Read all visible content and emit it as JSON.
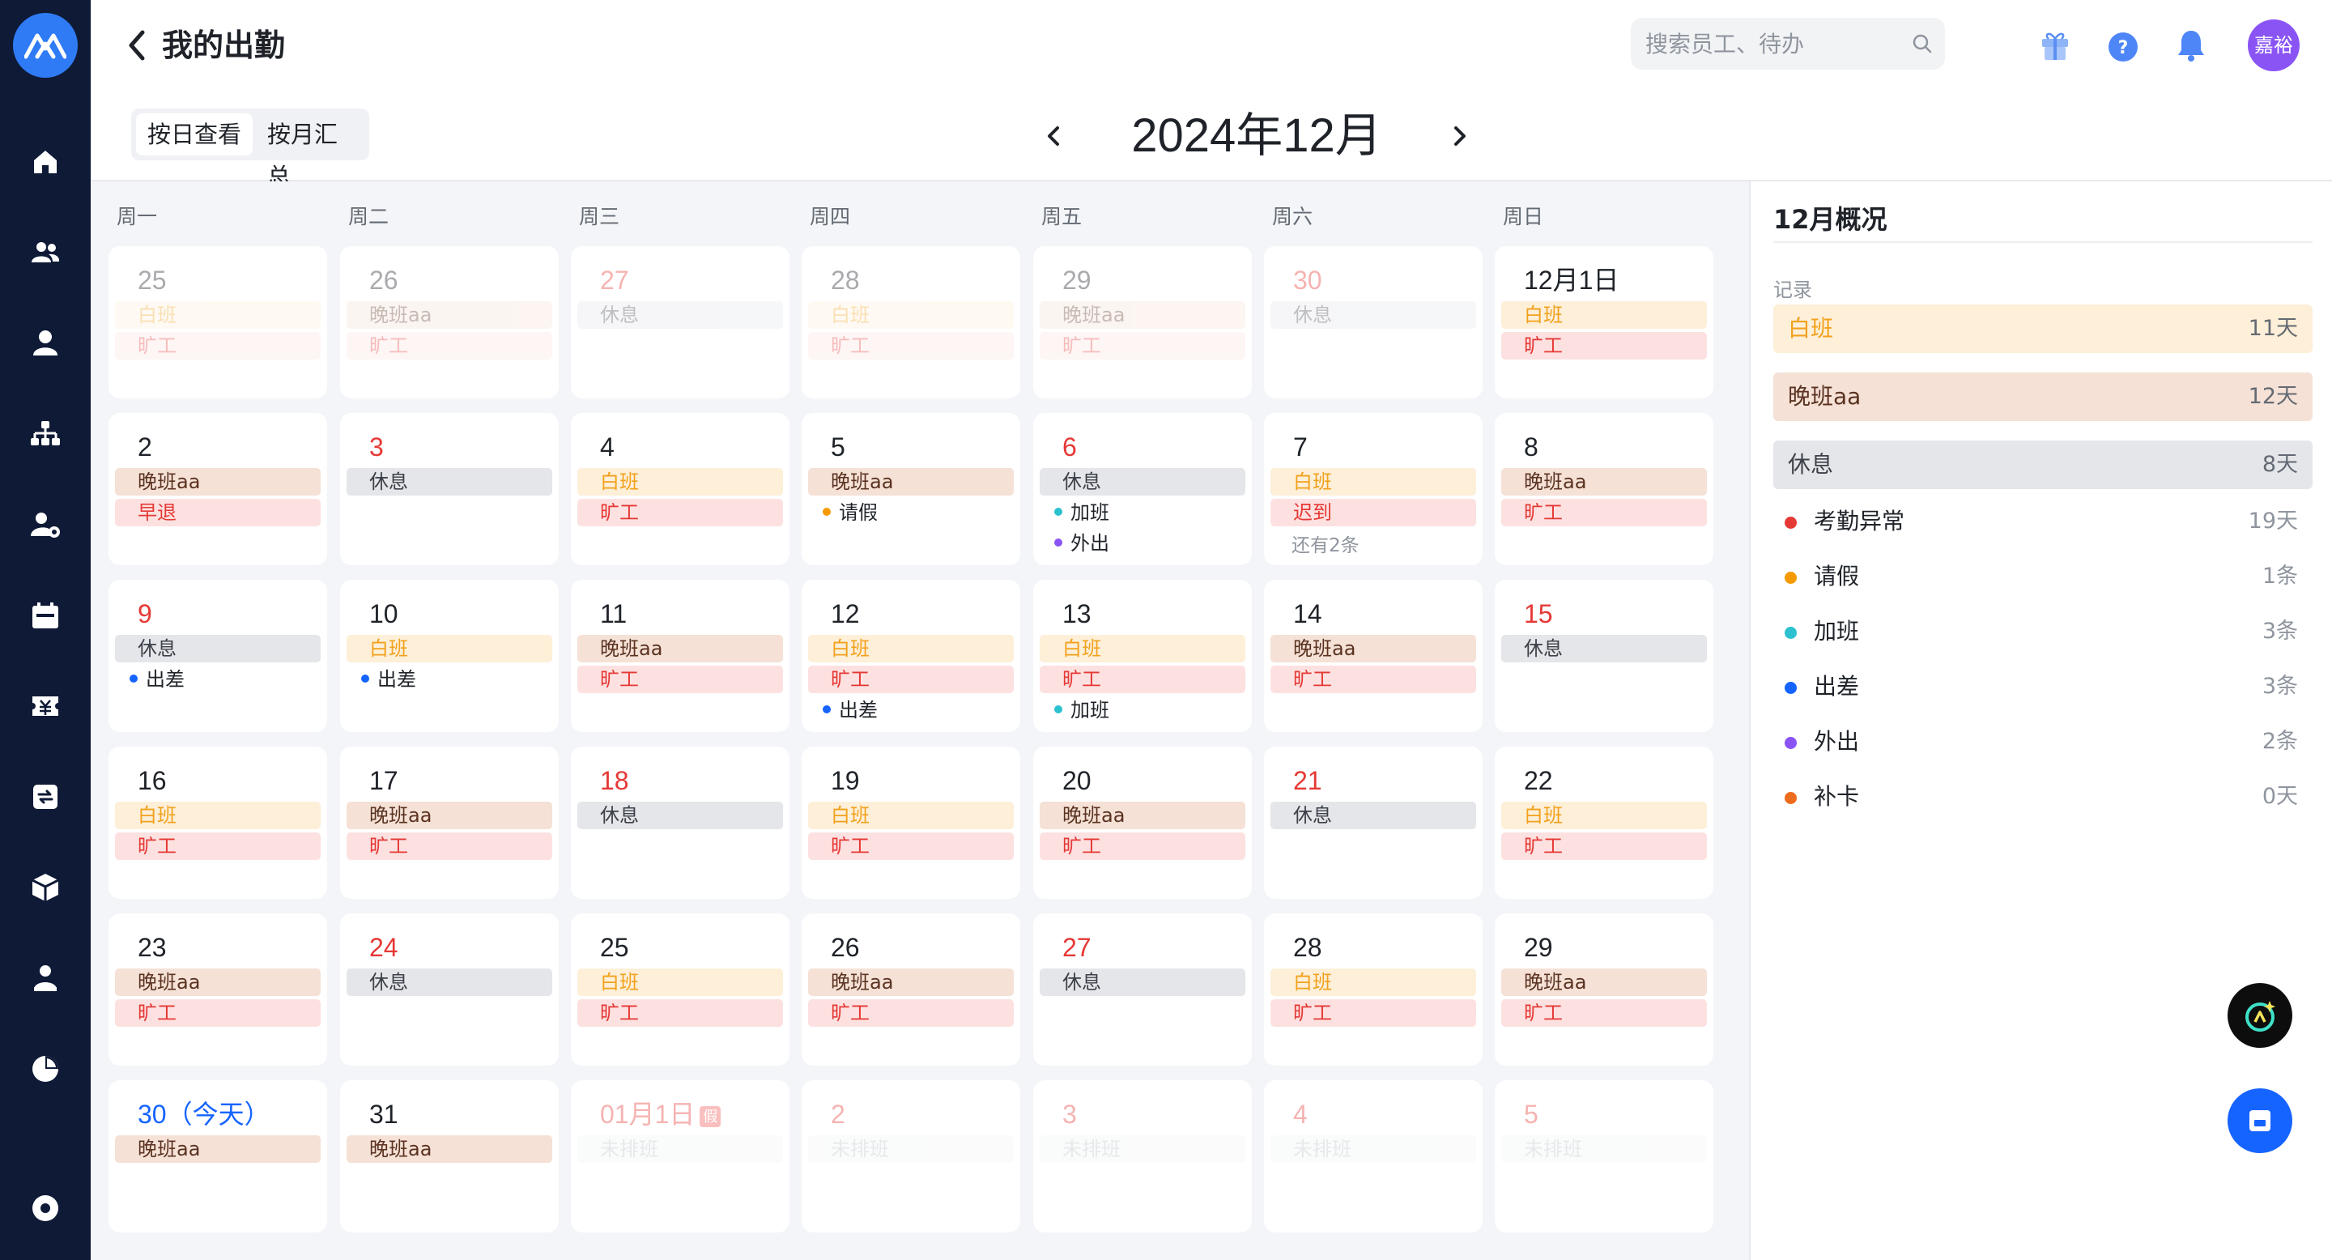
{
  "header": {
    "title": "我的出勤",
    "search_placeholder": "搜索员工、待办",
    "avatar_text": "嘉裕"
  },
  "view_toggle": [
    {
      "label": "按日查看",
      "active": true
    },
    {
      "label": "按月汇总",
      "active": false
    }
  ],
  "month_nav": {
    "title": "2024年12月"
  },
  "weekdays": [
    "周一",
    "周二",
    "周三",
    "周四",
    "周五",
    "周六",
    "周日"
  ],
  "weeks": [
    [
      {
        "date": "25",
        "dim": true,
        "color": "",
        "items": [
          {
            "kind": "day",
            "text": "白班"
          },
          {
            "kind": "abs",
            "text": "旷工"
          }
        ]
      },
      {
        "date": "26",
        "dim": true,
        "color": "",
        "items": [
          {
            "kind": "night",
            "text": "晚班aa"
          },
          {
            "kind": "abs",
            "text": "旷工"
          }
        ]
      },
      {
        "date": "27",
        "dim": true,
        "color": "red",
        "items": [
          {
            "kind": "rest",
            "text": "休息"
          }
        ]
      },
      {
        "date": "28",
        "dim": true,
        "color": "",
        "items": [
          {
            "kind": "day",
            "text": "白班"
          },
          {
            "kind": "abs",
            "text": "旷工"
          }
        ]
      },
      {
        "date": "29",
        "dim": true,
        "color": "",
        "items": [
          {
            "kind": "night",
            "text": "晚班aa"
          },
          {
            "kind": "abs",
            "text": "旷工"
          }
        ]
      },
      {
        "date": "30",
        "dim": true,
        "color": "red",
        "items": [
          {
            "kind": "rest",
            "text": "休息"
          }
        ]
      },
      {
        "date": "12月1日",
        "dim": false,
        "color": "",
        "items": [
          {
            "kind": "day",
            "text": "白班"
          },
          {
            "kind": "abs",
            "text": "旷工"
          }
        ]
      }
    ],
    [
      {
        "date": "2",
        "dim": false,
        "color": "",
        "items": [
          {
            "kind": "night",
            "text": "晚班aa"
          },
          {
            "kind": "early",
            "text": "早退"
          }
        ]
      },
      {
        "date": "3",
        "dim": false,
        "color": "red",
        "items": [
          {
            "kind": "rest",
            "text": "休息"
          }
        ]
      },
      {
        "date": "4",
        "dim": false,
        "color": "",
        "items": [
          {
            "kind": "day",
            "text": "白班"
          },
          {
            "kind": "abs",
            "text": "旷工"
          }
        ]
      },
      {
        "date": "5",
        "dim": false,
        "color": "",
        "items": [
          {
            "kind": "night",
            "text": "晚班aa"
          },
          {
            "kind": "dot",
            "text": "请假",
            "dot": "#f59a00"
          }
        ]
      },
      {
        "date": "6",
        "dim": false,
        "color": "red",
        "items": [
          {
            "kind": "rest",
            "text": "休息"
          },
          {
            "kind": "dot",
            "text": "加班",
            "dot": "#2bc1cf"
          },
          {
            "kind": "dot",
            "text": "外出",
            "dot": "#8a54f4"
          }
        ]
      },
      {
        "date": "7",
        "dim": false,
        "color": "",
        "items": [
          {
            "kind": "day",
            "text": "白班"
          },
          {
            "kind": "late",
            "text": "迟到"
          },
          {
            "kind": "more",
            "text": "还有2条"
          }
        ]
      },
      {
        "date": "8",
        "dim": false,
        "color": "",
        "items": [
          {
            "kind": "night",
            "text": "晚班aa"
          },
          {
            "kind": "abs",
            "text": "旷工"
          }
        ]
      }
    ],
    [
      {
        "date": "9",
        "dim": false,
        "color": "red",
        "items": [
          {
            "kind": "rest",
            "text": "休息"
          },
          {
            "kind": "dot",
            "text": "出差",
            "dot": "#1664ff"
          }
        ]
      },
      {
        "date": "10",
        "dim": false,
        "color": "",
        "items": [
          {
            "kind": "day",
            "text": "白班"
          },
          {
            "kind": "dot",
            "text": "出差",
            "dot": "#1664ff"
          }
        ]
      },
      {
        "date": "11",
        "dim": false,
        "color": "",
        "items": [
          {
            "kind": "night",
            "text": "晚班aa"
          },
          {
            "kind": "abs",
            "text": "旷工"
          }
        ]
      },
      {
        "date": "12",
        "dim": false,
        "color": "",
        "items": [
          {
            "kind": "day",
            "text": "白班"
          },
          {
            "kind": "abs",
            "text": "旷工"
          },
          {
            "kind": "dot",
            "text": "出差",
            "dot": "#1664ff"
          }
        ]
      },
      {
        "date": "13",
        "dim": false,
        "color": "",
        "items": [
          {
            "kind": "day",
            "text": "白班"
          },
          {
            "kind": "abs",
            "text": "旷工"
          },
          {
            "kind": "dot",
            "text": "加班",
            "dot": "#2bc1cf"
          }
        ]
      },
      {
        "date": "14",
        "dim": false,
        "color": "",
        "items": [
          {
            "kind": "night",
            "text": "晚班aa"
          },
          {
            "kind": "abs",
            "text": "旷工"
          }
        ]
      },
      {
        "date": "15",
        "dim": false,
        "color": "red",
        "items": [
          {
            "kind": "rest",
            "text": "休息"
          }
        ]
      }
    ],
    [
      {
        "date": "16",
        "dim": false,
        "color": "",
        "items": [
          {
            "kind": "day",
            "text": "白班"
          },
          {
            "kind": "abs",
            "text": "旷工"
          }
        ]
      },
      {
        "date": "17",
        "dim": false,
        "color": "",
        "items": [
          {
            "kind": "night",
            "text": "晚班aa"
          },
          {
            "kind": "abs",
            "text": "旷工"
          }
        ]
      },
      {
        "date": "18",
        "dim": false,
        "color": "red",
        "items": [
          {
            "kind": "rest",
            "text": "休息"
          }
        ]
      },
      {
        "date": "19",
        "dim": false,
        "color": "",
        "items": [
          {
            "kind": "day",
            "text": "白班"
          },
          {
            "kind": "abs",
            "text": "旷工"
          }
        ]
      },
      {
        "date": "20",
        "dim": false,
        "color": "",
        "items": [
          {
            "kind": "night",
            "text": "晚班aa"
          },
          {
            "kind": "abs",
            "text": "旷工"
          }
        ]
      },
      {
        "date": "21",
        "dim": false,
        "color": "red",
        "items": [
          {
            "kind": "rest",
            "text": "休息"
          }
        ]
      },
      {
        "date": "22",
        "dim": false,
        "color": "",
        "items": [
          {
            "kind": "day",
            "text": "白班"
          },
          {
            "kind": "abs",
            "text": "旷工"
          }
        ]
      }
    ],
    [
      {
        "date": "23",
        "dim": false,
        "color": "",
        "items": [
          {
            "kind": "night",
            "text": "晚班aa"
          },
          {
            "kind": "abs",
            "text": "旷工"
          }
        ]
      },
      {
        "date": "24",
        "dim": false,
        "color": "red",
        "items": [
          {
            "kind": "rest",
            "text": "休息"
          }
        ]
      },
      {
        "date": "25",
        "dim": false,
        "color": "",
        "items": [
          {
            "kind": "day",
            "text": "白班"
          },
          {
            "kind": "abs",
            "text": "旷工"
          }
        ]
      },
      {
        "date": "26",
        "dim": false,
        "color": "",
        "items": [
          {
            "kind": "night",
            "text": "晚班aa"
          },
          {
            "kind": "abs",
            "text": "旷工"
          }
        ]
      },
      {
        "date": "27",
        "dim": false,
        "color": "red",
        "items": [
          {
            "kind": "rest",
            "text": "休息"
          }
        ]
      },
      {
        "date": "28",
        "dim": false,
        "color": "",
        "items": [
          {
            "kind": "day",
            "text": "白班"
          },
          {
            "kind": "abs",
            "text": "旷工"
          }
        ]
      },
      {
        "date": "29",
        "dim": false,
        "color": "",
        "items": [
          {
            "kind": "night",
            "text": "晚班aa"
          },
          {
            "kind": "abs",
            "text": "旷工"
          }
        ]
      }
    ],
    [
      {
        "date": "30（今天）",
        "dim": false,
        "color": "blue",
        "items": [
          {
            "kind": "night",
            "text": "晚班aa"
          }
        ]
      },
      {
        "date": "31",
        "dim": false,
        "color": "",
        "items": [
          {
            "kind": "night",
            "text": "晚班aa"
          }
        ]
      },
      {
        "date": "01月1日",
        "dim": true,
        "color": "red",
        "badge": "假",
        "items": [
          {
            "kind": "none",
            "text": "未排班"
          }
        ]
      },
      {
        "date": "2",
        "dim": true,
        "color": "red",
        "items": [
          {
            "kind": "none",
            "text": "未排班"
          }
        ]
      },
      {
        "date": "3",
        "dim": true,
        "color": "red",
        "items": [
          {
            "kind": "none",
            "text": "未排班"
          }
        ]
      },
      {
        "date": "4",
        "dim": true,
        "color": "red",
        "items": [
          {
            "kind": "none",
            "text": "未排班"
          }
        ]
      },
      {
        "date": "5",
        "dim": true,
        "color": "red",
        "items": [
          {
            "kind": "none",
            "text": "未排班"
          }
        ]
      }
    ]
  ],
  "summary": {
    "title": "12月概况",
    "subtitle": "记录",
    "shifts": [
      {
        "label": "白班",
        "value": "11天",
        "bg": "#fdefd8",
        "color": "#f2a11c"
      },
      {
        "label": "晚班aa",
        "value": "12天",
        "bg": "#f5e1d6",
        "color": "#5a3220"
      },
      {
        "label": "休息",
        "value": "8天",
        "bg": "#e5e6ea",
        "color": "#3c4048"
      }
    ],
    "stats": [
      {
        "label": "考勤异常",
        "value": "19天",
        "dot": "#e53935"
      },
      {
        "label": "请假",
        "value": "1条",
        "dot": "#f59a00"
      },
      {
        "label": "加班",
        "value": "3条",
        "dot": "#2bc1cf"
      },
      {
        "label": "出差",
        "value": "3条",
        "dot": "#1664ff"
      },
      {
        "label": "外出",
        "value": "2条",
        "dot": "#8a54f4"
      },
      {
        "label": "补卡",
        "value": "0天",
        "dot": "#ec6b1c"
      }
    ]
  },
  "sidebar_icons": [
    "home-icon",
    "team-icon",
    "user-icon",
    "org-chart-icon",
    "user-settings-icon",
    "calendar-icon",
    "salary-icon",
    "approval-icon",
    "package-icon",
    "profile-icon",
    "report-icon",
    "settings-icon"
  ]
}
